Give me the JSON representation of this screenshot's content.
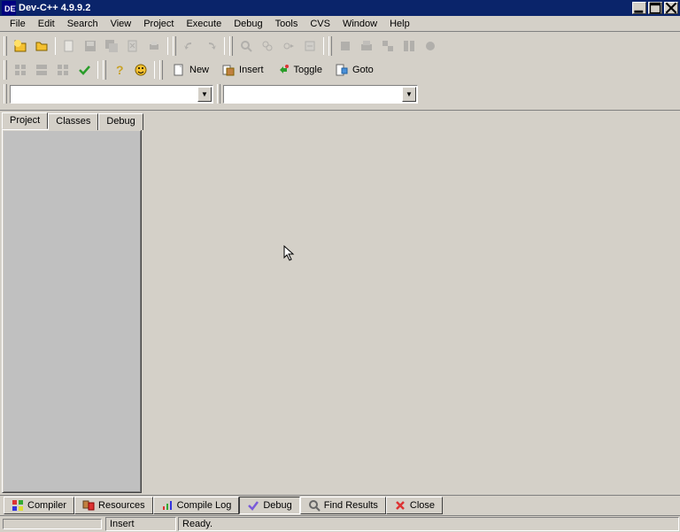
{
  "window": {
    "title": "Dev-C++ 4.9.9.2"
  },
  "menu": [
    "File",
    "Edit",
    "Search",
    "View",
    "Project",
    "Execute",
    "Debug",
    "Tools",
    "CVS",
    "Window",
    "Help"
  ],
  "toolbar2": {
    "new_label": "New",
    "insert_label": "Insert",
    "toggle_label": "Toggle",
    "goto_label": "Goto"
  },
  "sidebar_tabs": [
    "Project",
    "Classes",
    "Debug"
  ],
  "bottom_tabs": [
    {
      "label": "Compiler"
    },
    {
      "label": "Resources"
    },
    {
      "label": "Compile Log"
    },
    {
      "label": "Debug"
    },
    {
      "label": "Find Results"
    },
    {
      "label": "Close"
    }
  ],
  "status": {
    "mode": "Insert",
    "msg": "Ready."
  }
}
